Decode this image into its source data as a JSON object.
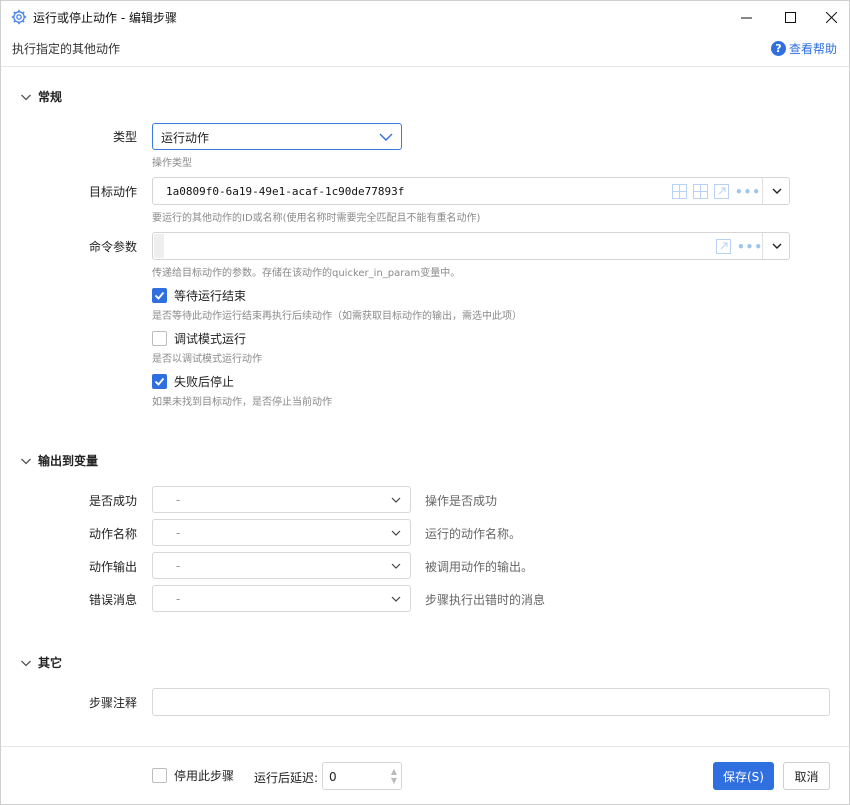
{
  "window": {
    "title": "运行或停止动作 - 编辑步骤",
    "subtitle": "执行指定的其他动作",
    "help_label": "查看帮助"
  },
  "sections": {
    "general": "常规",
    "output": "输出到变量",
    "other": "其它"
  },
  "general": {
    "type_label": "类型",
    "type_value": "运行动作",
    "type_hint": "操作类型",
    "target_label": "目标动作",
    "target_value": "1a0809f0-6a19-49e1-acaf-1c90de77893f",
    "target_hint": "要运行的其他动作的ID或名称(使用名称时需要完全匹配且不能有重名动作)",
    "params_label": "命令参数",
    "params_value": "",
    "params_hint": "传递给目标动作的参数。存储在该动作的quicker_in_param变量中。",
    "wait_label": "等待运行结束",
    "wait_checked": true,
    "wait_hint": "是否等待此动作运行结束再执行后续动作（如需获取目标动作的输出，需选中此项）",
    "debug_label": "调试模式运行",
    "debug_checked": false,
    "debug_hint": "是否以调试模式运行动作",
    "stop_label": "失败后停止",
    "stop_checked": true,
    "stop_hint": "如果未找到目标动作，是否停止当前动作"
  },
  "outputs": [
    {
      "label": "是否成功",
      "value": "-",
      "desc": "操作是否成功"
    },
    {
      "label": "动作名称",
      "value": "-",
      "desc": "运行的动作名称。"
    },
    {
      "label": "动作输出",
      "value": "-",
      "desc": "被调用动作的输出。"
    },
    {
      "label": "错误消息",
      "value": "-",
      "desc": "步骤执行出错时的消息"
    }
  ],
  "other": {
    "note_label": "步骤注释",
    "note_value": ""
  },
  "footer": {
    "disable_label": "停用此步骤",
    "disable_checked": false,
    "delay_label": "运行后延迟:",
    "delay_value": "0",
    "save_label": "保存(S)",
    "cancel_label": "取消"
  },
  "colors": {
    "accent": "#2f6fe0",
    "hint_text": "#8a8a8a",
    "border": "#d5d5d5"
  }
}
